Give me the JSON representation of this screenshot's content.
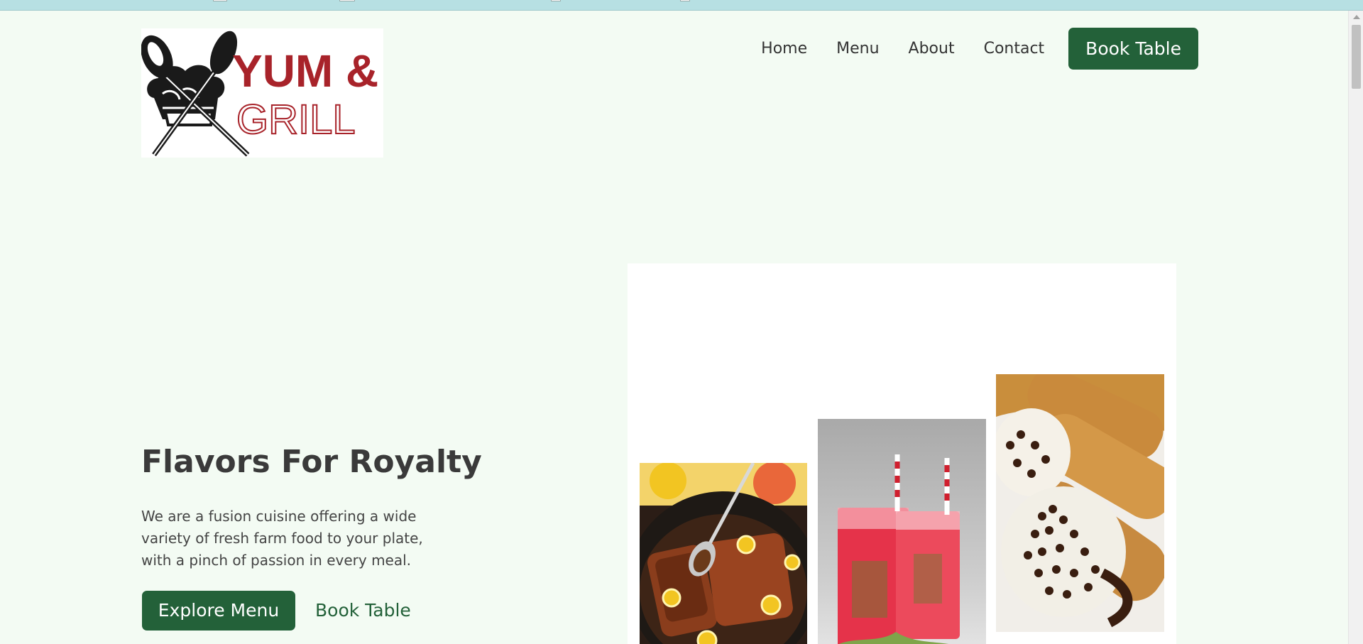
{
  "header": {
    "logo": {
      "line1": "YUM &",
      "line2": "GRILL",
      "icon": "crossed-spoons-chef-hat-icon"
    },
    "nav": [
      {
        "label": "Home"
      },
      {
        "label": "Menu"
      },
      {
        "label": "About"
      },
      {
        "label": "Contact"
      }
    ],
    "cta_label": "Book Table"
  },
  "hero": {
    "title": "Flavors For Royalty",
    "description": "We are a fusion cuisine offering a wide variety of fresh farm food to your plate, with a pinch of passion in every meal.",
    "primary_button": "Explore Menu",
    "secondary_button": "Book Table"
  },
  "gallery": {
    "images": [
      {
        "subject": "glazed salmon in skillet with lemon slices"
      },
      {
        "subject": "red mojito drinks with striped straws"
      },
      {
        "subject": "chocolate chip cannoli"
      }
    ]
  },
  "colors": {
    "brand_green": "#236139",
    "logo_red": "#a8232a",
    "background": "#f3fbf3",
    "top_strip": "#b7e0e3"
  }
}
